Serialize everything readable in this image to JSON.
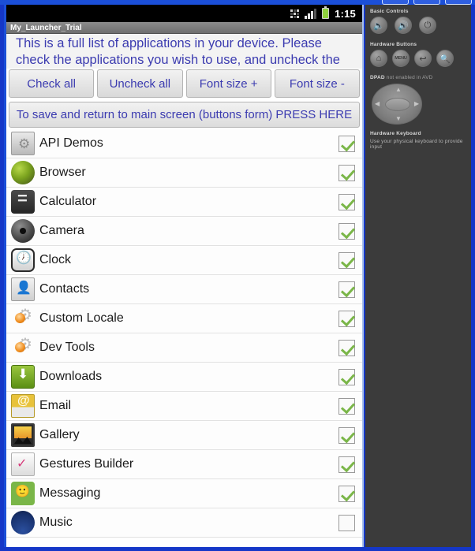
{
  "window": {
    "buttons": [
      "minimize",
      "maximize",
      "close"
    ]
  },
  "device": {
    "statusbar": {
      "network_icon": "3g-network-icon",
      "signal_icon": "signal-bars-icon",
      "battery_icon": "battery-icon",
      "time": "1:15"
    },
    "app_title": "My_Launcher_Trial",
    "instructions": "This is a full list of applications in your device. Please check the applications you wish to use, and uncheck the ones you do not",
    "action_buttons": [
      {
        "label": "Check all",
        "name": "check-all-button"
      },
      {
        "label": "Uncheck all",
        "name": "uncheck-all-button"
      },
      {
        "label": "Font size +",
        "name": "font-size-increase-button"
      },
      {
        "label": "Font size -",
        "name": "font-size-decrease-button"
      }
    ],
    "save_button": "To save and return to main screen (buttons form) PRESS HERE",
    "apps": [
      {
        "name": "API Demos",
        "icon": "folder-gear-icon",
        "checked": true
      },
      {
        "name": "Browser",
        "icon": "globe-icon",
        "checked": true
      },
      {
        "name": "Calculator",
        "icon": "calculator-icon",
        "checked": true
      },
      {
        "name": "Camera",
        "icon": "camera-icon",
        "checked": true
      },
      {
        "name": "Clock",
        "icon": "clock-icon",
        "checked": true
      },
      {
        "name": "Contacts",
        "icon": "contacts-icon",
        "checked": true
      },
      {
        "name": "Custom Locale",
        "icon": "gear-orange-icon",
        "checked": true
      },
      {
        "name": "Dev Tools",
        "icon": "gear-orange-icon",
        "checked": true
      },
      {
        "name": "Downloads",
        "icon": "download-icon",
        "checked": true
      },
      {
        "name": "Email",
        "icon": "email-icon",
        "checked": true
      },
      {
        "name": "Gallery",
        "icon": "gallery-icon",
        "checked": true
      },
      {
        "name": "Gestures Builder",
        "icon": "gestures-icon",
        "checked": true
      },
      {
        "name": "Messaging",
        "icon": "messaging-icon",
        "checked": true
      },
      {
        "name": "Music",
        "icon": "music-icon",
        "checked": false
      }
    ]
  },
  "control_panel": {
    "basic_controls_label": "Basic Controls",
    "basic_controls": [
      {
        "label": "🔈",
        "name": "volume-down-button"
      },
      {
        "label": "🔊",
        "name": "volume-up-button"
      },
      {
        "label": "⏻",
        "name": "power-button"
      }
    ],
    "hardware_buttons_label": "Hardware Buttons",
    "hardware_buttons": [
      {
        "label": "⌂",
        "name": "home-button"
      },
      {
        "label": "MENU",
        "name": "menu-button"
      },
      {
        "label": "↩",
        "name": "back-button"
      },
      {
        "label": "🔍",
        "name": "search-button"
      }
    ],
    "dpad_label": "DPAD",
    "dpad_note": "not enabled in AVD",
    "keyboard_label": "Hardware Keyboard",
    "keyboard_note": "Use your physical keyboard to provide input"
  }
}
